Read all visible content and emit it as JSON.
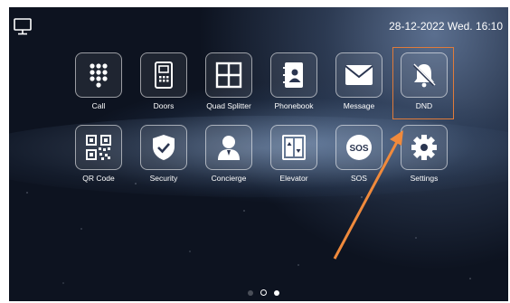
{
  "status_bar": {
    "datetime": "28-12-2022 Wed. 16:10"
  },
  "apps_row1": [
    {
      "label": "Call",
      "icon": "keypad-icon"
    },
    {
      "label": "Doors",
      "icon": "door-panel-icon"
    },
    {
      "label": "Quad Splitter",
      "icon": "grid-icon"
    },
    {
      "label": "Phonebook",
      "icon": "phonebook-icon"
    },
    {
      "label": "Message",
      "icon": "envelope-icon"
    },
    {
      "label": "DND",
      "icon": "bell-off-icon"
    }
  ],
  "apps_row2": [
    {
      "label": "QR Code",
      "icon": "qr-code-icon"
    },
    {
      "label": "Security",
      "icon": "shield-icon"
    },
    {
      "label": "Concierge",
      "icon": "concierge-icon"
    },
    {
      "label": "Elevator",
      "icon": "elevator-icon"
    },
    {
      "label": "SOS",
      "icon": "sos-icon"
    },
    {
      "label": "Settings",
      "icon": "gear-icon"
    }
  ],
  "pages": {
    "current": 3,
    "total": 3
  },
  "colors": {
    "highlight": "#e07b3a",
    "arrow": "#f08a3c",
    "text": "#ffffff"
  }
}
